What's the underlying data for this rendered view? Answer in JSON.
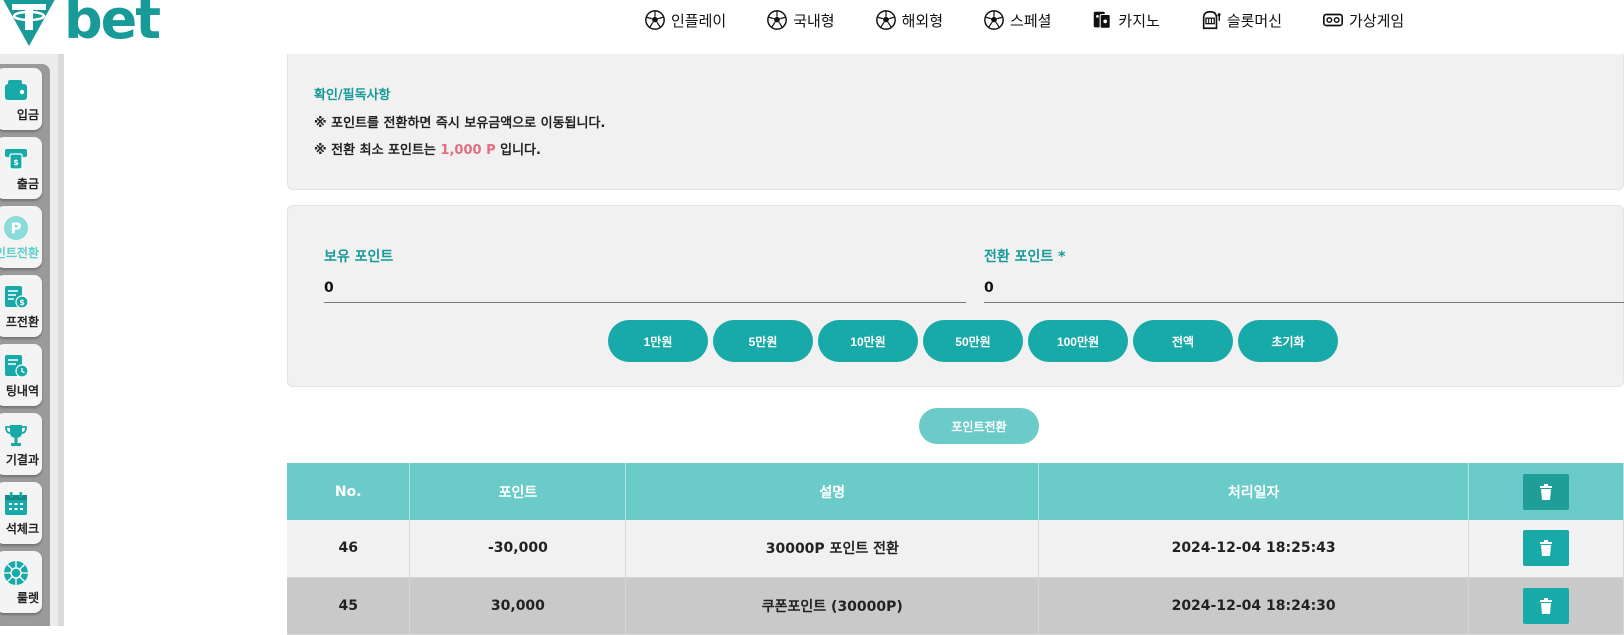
{
  "brand": {
    "logo_text": "bet",
    "accent": "#179a98"
  },
  "topnav": [
    {
      "label": "인플레이",
      "icon": "soccer-ball-icon"
    },
    {
      "label": "국내형",
      "icon": "soccer-ball-icon"
    },
    {
      "label": "해외형",
      "icon": "soccer-ball-icon"
    },
    {
      "label": "스페셜",
      "icon": "soccer-ball-icon"
    },
    {
      "label": "카지노",
      "icon": "cards-icon"
    },
    {
      "label": "슬롯머신",
      "icon": "slot-machine-icon"
    },
    {
      "label": "가상게임",
      "icon": "vr-goggles-icon"
    }
  ],
  "sidebar": {
    "items": [
      {
        "label": "입금",
        "icon": "wallet-icon"
      },
      {
        "label": "출금",
        "icon": "withdraw-icon"
      },
      {
        "label": "인트전환",
        "icon": "point-icon",
        "active": true
      },
      {
        "label": "프전환",
        "icon": "coin-exchange-icon"
      },
      {
        "label": "팅내역",
        "icon": "history-icon"
      },
      {
        "label": "기결과",
        "icon": "trophy-icon"
      },
      {
        "label": "석체크",
        "icon": "calendar-icon"
      },
      {
        "label": "룰렛",
        "icon": "roulette-icon"
      }
    ]
  },
  "notice": {
    "title": "확인/필독사항",
    "line1": "※ 포인트를 전환하면 즉시 보유금액으로 이동됩니다.",
    "line2_prefix": "※ 전환 최소 포인트는 ",
    "line2_highlight": "1,000 P",
    "line2_suffix": " 입니다."
  },
  "form": {
    "held_points_label": "보유 포인트",
    "held_points_value": "0",
    "convert_points_label": "전환 포인트 *",
    "convert_points_value": "0",
    "amount_buttons": [
      "1만원",
      "5만원",
      "10만원",
      "50만원",
      "100만원",
      "전액",
      "초기화"
    ],
    "submit_label": "포인트전환"
  },
  "table": {
    "headers": [
      "No.",
      "포인트",
      "설명",
      "처리일자"
    ],
    "rows": [
      {
        "no": "46",
        "points": "-30,000",
        "description": "30000P 포인트 전환",
        "date": "2024-12-04 18:25:43"
      },
      {
        "no": "45",
        "points": "30,000",
        "description": "쿠폰포인트 (30000P)",
        "date": "2024-12-04 18:24:30"
      }
    ]
  }
}
